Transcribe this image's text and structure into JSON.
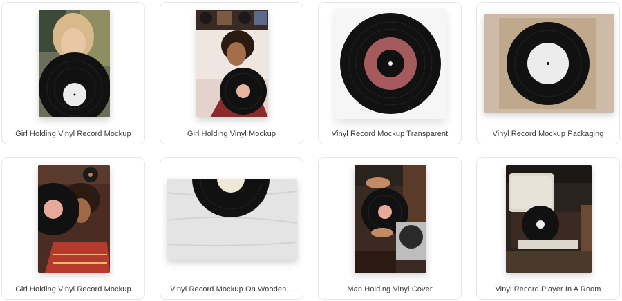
{
  "gallery": {
    "items": [
      {
        "title": "Girl Holding Vinyl Record Mockup"
      },
      {
        "title": "Girl Holding Vinyl Mockup"
      },
      {
        "title": "Vinyl Record Mockup Transparent"
      },
      {
        "title": "Vinyl Record Mockup Packaging"
      },
      {
        "title": "Girl Holding Vinyl Record Mockup"
      },
      {
        "title": "Vinyl Record Mockup On Wooden..."
      },
      {
        "title": "Man Holding Vinyl Cover"
      },
      {
        "title": "Vinyl Record Player In A Room"
      }
    ]
  },
  "colors": {
    "card_border": "#e6e6ea",
    "label_text": "#3a3a3f",
    "vinyl_black": "#111111",
    "label_red": "#a55a5c"
  }
}
